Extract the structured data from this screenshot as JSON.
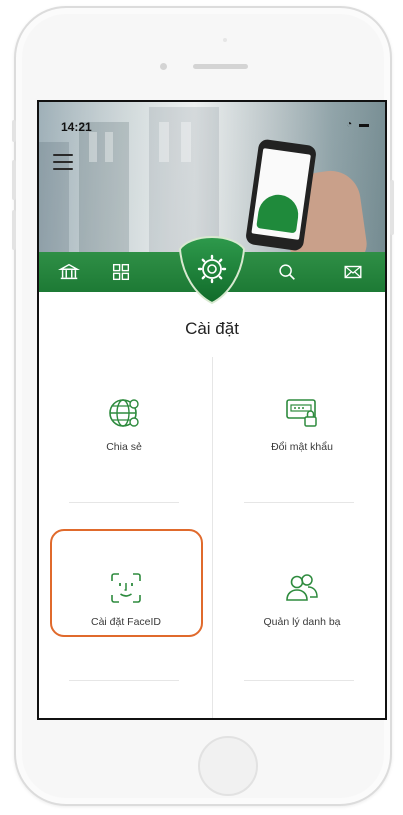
{
  "status": {
    "time": "14:21"
  },
  "title": "Cài đặt",
  "nav": [
    {
      "name": "bank-icon"
    },
    {
      "name": "grid-icon"
    },
    {
      "name": "gear-icon"
    },
    {
      "name": "search-icon"
    },
    {
      "name": "mail-icon"
    }
  ],
  "tiles": [
    {
      "label": "Chia sẻ",
      "icon": "globe-share-icon"
    },
    {
      "label": "Đổi mật khẩu",
      "icon": "password-lock-icon"
    },
    {
      "label": "Cài đặt FaceID",
      "icon": "faceid-icon"
    },
    {
      "label": "Quản lý danh bạ",
      "icon": "contacts-icon"
    }
  ],
  "colors": {
    "brand": "#1d7a35",
    "highlight": "#e06a2c"
  }
}
